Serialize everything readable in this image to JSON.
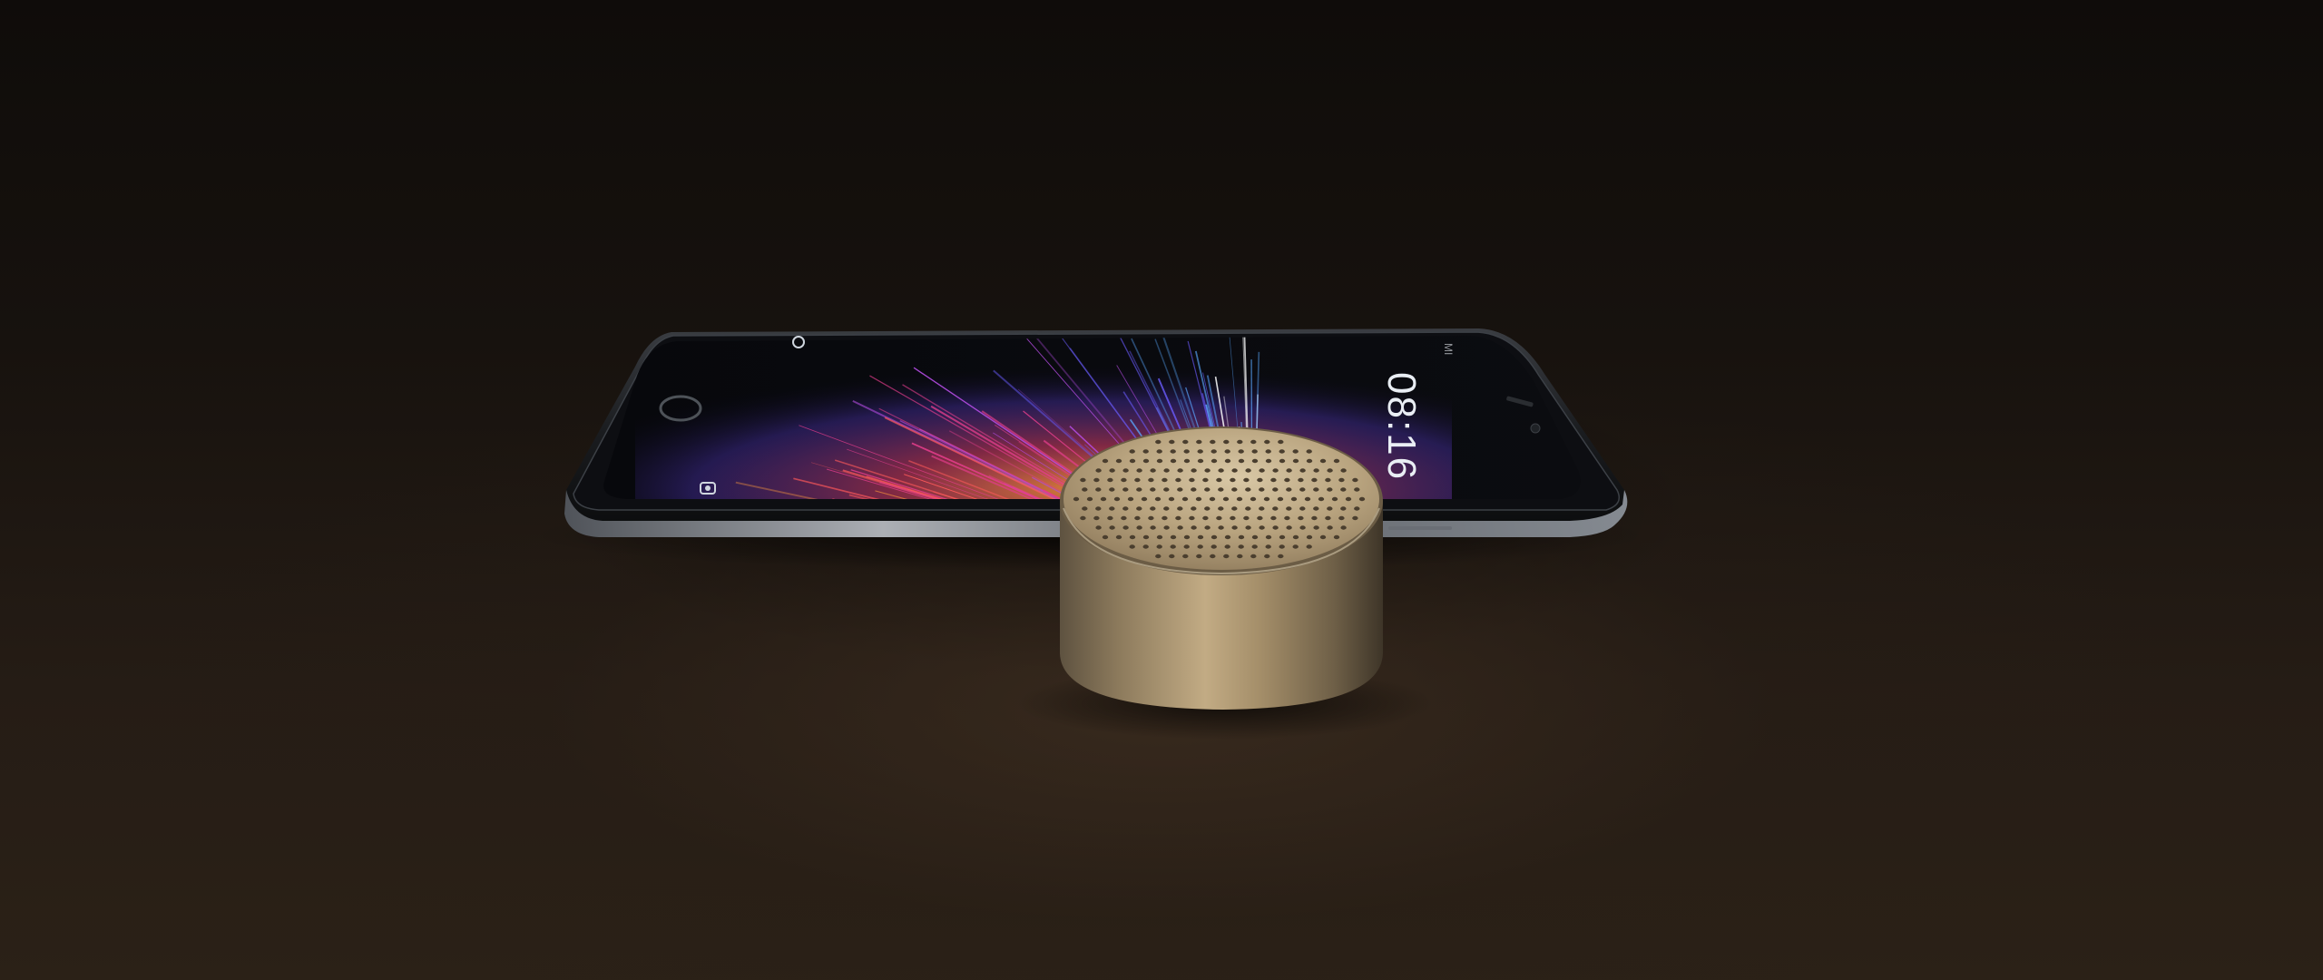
{
  "scene": {
    "phone": {
      "lock_screen": {
        "clock": "08:16",
        "carrier_status": "",
        "wallpaper": "light-burst"
      },
      "brand_mark": "MI",
      "color": "#121417"
    },
    "speaker": {
      "finish": "gold",
      "color": "#a08a64"
    }
  }
}
